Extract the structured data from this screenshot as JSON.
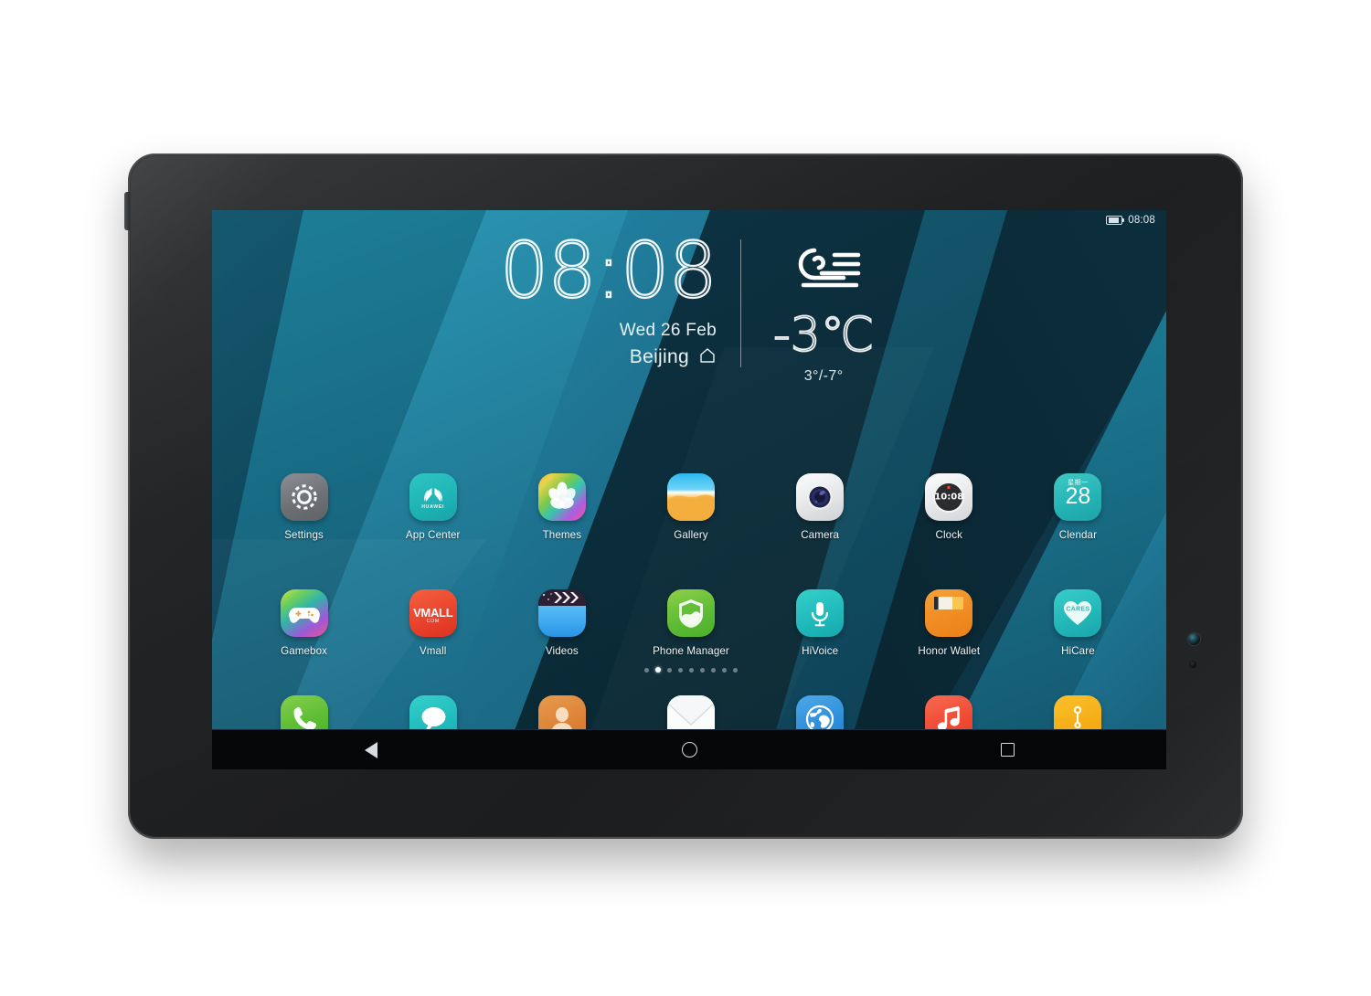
{
  "device": {
    "name": "Huawei MediaPad tablet",
    "bezel_color": "#26282a",
    "camera_name": "front-camera",
    "sensor_name": "ambient-sensor"
  },
  "status_bar": {
    "clock": "08:08",
    "battery_icon": "battery-icon",
    "battery_level_percent": 70
  },
  "widget": {
    "time": "08:08",
    "date": "Wed 26 Feb",
    "city": "Beijing",
    "home_icon": "home-icon",
    "weather_icon": "foggy-windy-icon",
    "temperature": "-3℃",
    "temperature_range": "3°/-7°"
  },
  "home_screen": {
    "wallpaper_colors": [
      "#0d3745",
      "#145f73",
      "#1b7f96",
      "#2a8fae",
      "#123a4e",
      "#0f4a63",
      "#1d6f8c"
    ],
    "rows": [
      [
        {
          "label": "Settings",
          "icon": "settings-gear-icon",
          "style": "ic-settings"
        },
        {
          "label": "App Center",
          "icon": "huawei-appcenter-icon",
          "style": "ic-appcenter",
          "sub": "HUAWEI"
        },
        {
          "label": "Themes",
          "icon": "themes-pinwheel-icon",
          "style": "ic-themes"
        },
        {
          "label": "Gallery",
          "icon": "gallery-landscape-icon",
          "style": "ic-gallery"
        },
        {
          "label": "Camera",
          "icon": "camera-lens-icon",
          "style": "ic-camera"
        },
        {
          "label": "Clock",
          "icon": "clock-face-icon",
          "style": "ic-clock",
          "sub": "10:08"
        },
        {
          "label": "Clendar",
          "icon": "calendar-date-icon",
          "style": "ic-calendar",
          "sub": "28",
          "sub2": "星期一"
        }
      ],
      [
        {
          "label": "Gamebox",
          "icon": "gamepad-icon",
          "style": "ic-gamebox"
        },
        {
          "label": "Vmall",
          "icon": "vmall-icon",
          "style": "ic-vmall",
          "sub": "VMALL",
          "sub2": "COM"
        },
        {
          "label": "Videos",
          "icon": "clapperboard-icon",
          "style": "ic-videos"
        },
        {
          "label": "Phone Manager",
          "icon": "shield-icon",
          "style": "ic-phonemgr"
        },
        {
          "label": "HiVoice",
          "icon": "microphone-icon",
          "style": "ic-hivoice"
        },
        {
          "label": "Honor Wallet",
          "icon": "wallet-icon",
          "style": "ic-wallet"
        },
        {
          "label": "HiCare",
          "icon": "heart-icon",
          "style": "ic-hicare",
          "sub": "CARES"
        }
      ],
      [
        {
          "label": "Dialer",
          "icon": "phone-handset-icon",
          "style": "ic-dialer"
        },
        {
          "label": "Messaging",
          "icon": "speech-bubble-icon",
          "style": "ic-messaging"
        },
        {
          "label": "Contacts",
          "icon": "person-icon",
          "style": "ic-contacts"
        },
        {
          "label": "Email",
          "icon": "envelope-icon",
          "style": "ic-email"
        },
        {
          "label": "Browser",
          "icon": "globe-icon",
          "style": "ic-browser"
        },
        {
          "label": "Music",
          "icon": "music-note-icon",
          "style": "ic-music"
        },
        {
          "label": "Files",
          "icon": "files-folder-icon",
          "style": "ic-files"
        }
      ]
    ],
    "page_indicator": {
      "total": 9,
      "active_index": 1
    }
  },
  "nav_bar": {
    "back_label": "Back",
    "home_label": "Home",
    "recents_label": "Recents",
    "back_icon": "back-triangle-icon",
    "home_icon": "home-circle-icon",
    "recents_icon": "recents-square-icon"
  }
}
